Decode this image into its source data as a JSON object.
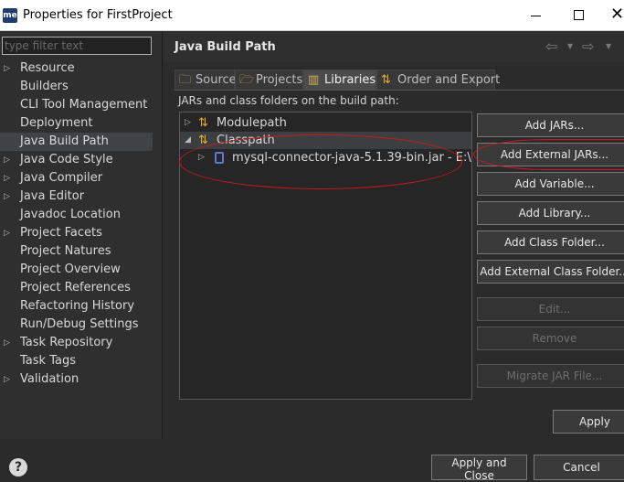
{
  "window": {
    "app_icon": "me",
    "title": "Properties for FirstProject",
    "minimize_icon": "minimize-icon",
    "maximize_icon": "maximize-icon",
    "close_icon": "close-icon",
    "close_glyph": "✕"
  },
  "filter": {
    "placeholder": "type filter text",
    "value": ""
  },
  "nav": {
    "items": [
      {
        "label": "Resource",
        "expandable": true
      },
      {
        "label": "Builders",
        "expandable": false
      },
      {
        "label": "CLI Tool Management",
        "expandable": false
      },
      {
        "label": "Deployment",
        "expandable": false
      },
      {
        "label": "Java Build Path",
        "expandable": false,
        "selected": true
      },
      {
        "label": "Java Code Style",
        "expandable": true
      },
      {
        "label": "Java Compiler",
        "expandable": true
      },
      {
        "label": "Java Editor",
        "expandable": true
      },
      {
        "label": "Javadoc Location",
        "expandable": false
      },
      {
        "label": "Project Facets",
        "expandable": true
      },
      {
        "label": "Project Natures",
        "expandable": false
      },
      {
        "label": "Project Overview",
        "expandable": false
      },
      {
        "label": "Project References",
        "expandable": false
      },
      {
        "label": "Refactoring History",
        "expandable": false
      },
      {
        "label": "Run/Debug Settings",
        "expandable": false
      },
      {
        "label": "Task Repository",
        "expandable": true
      },
      {
        "label": "Task Tags",
        "expandable": false
      },
      {
        "label": "Validation",
        "expandable": true
      }
    ]
  },
  "header": {
    "title": "Java Build Path",
    "back_icon": "back-arrow-icon",
    "forward_icon": "forward-arrow-icon"
  },
  "tabs": [
    {
      "label": "Source",
      "icon": "source-folder-icon",
      "active": false
    },
    {
      "label": "Projects",
      "icon": "projects-folder-icon",
      "active": false
    },
    {
      "label": "Libraries",
      "icon": "libraries-icon",
      "active": true
    },
    {
      "label": "Order and Export",
      "icon": "order-export-icon",
      "active": false
    }
  ],
  "build_path_label": "JARs and class folders on the build path:",
  "tree": {
    "modulepath": "Modulepath",
    "classpath": "Classpath",
    "jar": "mysql-connector-java-5.1.39-bin.jar - E:\\"
  },
  "buttons": {
    "add_jars": "Add JARs...",
    "add_external_jars": "Add External JARs...",
    "add_variable": "Add Variable...",
    "add_library": "Add Library...",
    "add_class_folder": "Add Class Folder...",
    "add_external_class_folder": "Add External Class Folder...",
    "edit": "Edit...",
    "remove": "Remove",
    "migrate_jar": "Migrate JAR File...",
    "apply": "Apply"
  },
  "footer": {
    "help_icon": "help-icon",
    "help_glyph": "?",
    "apply_and_close": "Apply and Close",
    "cancel": "Cancel"
  },
  "colors": {
    "background": "#2b2b2b",
    "annotation_red": "#d01818",
    "jar_icon_blue": "#5b78d8",
    "classpath_icon_gold": "#e8b020"
  }
}
